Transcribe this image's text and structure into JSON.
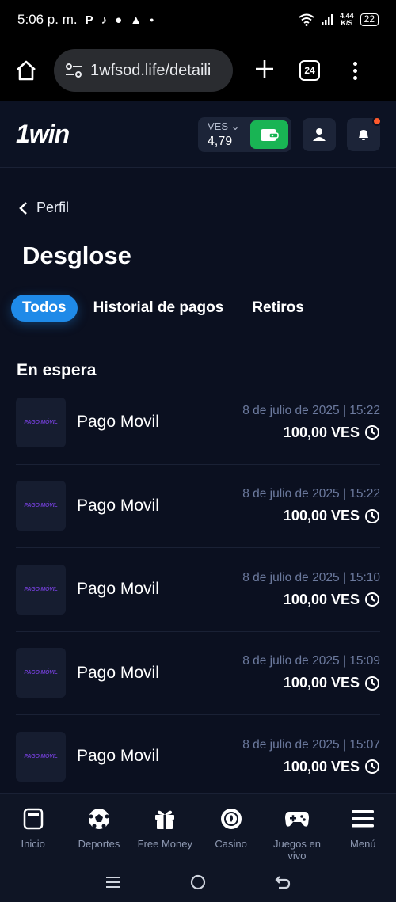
{
  "status_bar": {
    "time": "5:06 p. m.",
    "speed_top": "4,44",
    "speed_bottom": "K/S",
    "battery": "22"
  },
  "browser": {
    "url": "1wfsod.life/detaili",
    "tab_count": "24"
  },
  "header": {
    "logo": "1win",
    "currency": "VES",
    "balance": "4,79"
  },
  "page": {
    "back_label": "Perfil",
    "title": "Desglose",
    "tabs": [
      "Todos",
      "Historial de pagos",
      "Retiros"
    ],
    "section_title": "En espera"
  },
  "transactions": [
    {
      "logo_text": "PAGO MÓVIL",
      "name": "Pago Movil",
      "date": "8 de julio de 2025 | 15:22",
      "amount": "100,00 VES"
    },
    {
      "logo_text": "PAGO MÓVIL",
      "name": "Pago Movil",
      "date": "8 de julio de 2025 | 15:22",
      "amount": "100,00 VES"
    },
    {
      "logo_text": "PAGO MÓVIL",
      "name": "Pago Movil",
      "date": "8 de julio de 2025 | 15:10",
      "amount": "100,00 VES"
    },
    {
      "logo_text": "PAGO MÓVIL",
      "name": "Pago Movil",
      "date": "8 de julio de 2025 | 15:09",
      "amount": "100,00 VES"
    },
    {
      "logo_text": "PAGO MÓVIL",
      "name": "Pago Movil",
      "date": "8 de julio de 2025 | 15:07",
      "amount": "100,00 VES"
    }
  ],
  "bottom_nav": [
    {
      "label": "Inicio",
      "icon": "home-icon"
    },
    {
      "label": "Deportes",
      "icon": "soccer-ball-icon"
    },
    {
      "label": "Free Money",
      "icon": "gift-icon"
    },
    {
      "label": "Casino",
      "icon": "casino-chip-icon"
    },
    {
      "label": "Juegos en vivo",
      "icon": "gamepad-icon"
    },
    {
      "label": "Menú",
      "icon": "menu-icon"
    }
  ],
  "colors": {
    "background": "#0b1020",
    "accent_blue": "#1f8ae8",
    "wallet_green": "#19b454",
    "notification": "#ff5a2c",
    "date_text": "#6c7a9e"
  }
}
